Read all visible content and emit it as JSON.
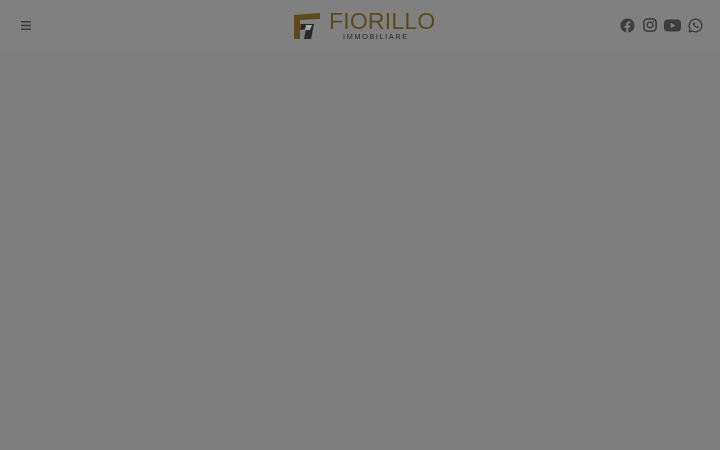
{
  "header": {
    "menu_icon": "hamburger-menu-icon",
    "logo": {
      "title": "FIORILLO",
      "subtitle": "IMMOBILIARE",
      "mark_icon": "fiorillo-logo-mark",
      "title_color": "#5c4a1e",
      "subtitle_color": "#2f2a1e"
    },
    "social": [
      {
        "name": "facebook",
        "icon": "facebook-icon"
      },
      {
        "name": "instagram",
        "icon": "instagram-icon"
      },
      {
        "name": "youtube",
        "icon": "youtube-icon"
      },
      {
        "name": "whatsapp",
        "icon": "whatsapp-icon"
      }
    ]
  },
  "colors": {
    "overlay_background": "#7f7f7f",
    "header_background": "#808080",
    "icon_color": "#3d3d3d"
  }
}
